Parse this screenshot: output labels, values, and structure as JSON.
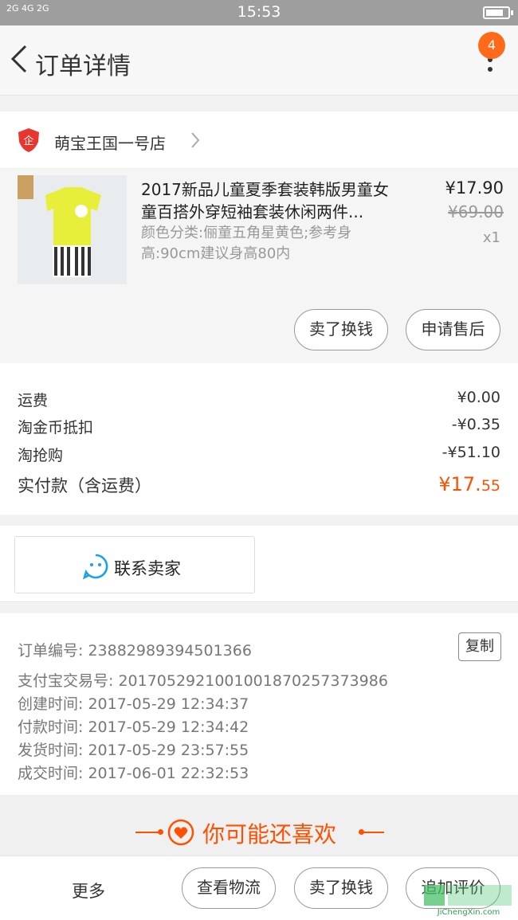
{
  "status_bar": {
    "signal": "2G 4G 2G",
    "time": "15:53"
  },
  "header": {
    "title": "订单详情",
    "badge": "4"
  },
  "shop": {
    "name": "萌宝王国一号店"
  },
  "product": {
    "title": "2017新品儿童夏季套装韩版男童女童百搭外穿短袖套装休闲两件...",
    "spec": "颜色分类:俪童五角星黄色;参考身高:90cm建议身高80内",
    "price": "¥17.90",
    "original_price": "¥69.00",
    "quantity": "x1",
    "actions": [
      "卖了换钱",
      "申请售后"
    ]
  },
  "summary": {
    "rows": [
      {
        "label": "运费",
        "value": "¥0.00"
      },
      {
        "label": "淘金币抵扣",
        "value": "-¥0.35"
      },
      {
        "label": "淘抢购",
        "value": "-¥51.10"
      }
    ],
    "total_label": "实付款（含运费）",
    "total_int": "¥17.",
    "total_dec": "55"
  },
  "contact": {
    "label": "联系卖家"
  },
  "order_info": {
    "copy_label": "复制",
    "rows": [
      "订单编号: 23882989394501366",
      "支付宝交易号: 2017052921001001870257373986",
      "创建时间: 2017-05-29 12:34:37",
      "付款时间: 2017-05-29 12:34:42",
      "发货时间: 2017-05-29 23:57:55",
      "成交时间: 2017-06-01 22:32:53"
    ]
  },
  "recommend": {
    "title": "你可能还喜欢"
  },
  "bottom_bar": {
    "more": "更多",
    "buttons": [
      "查看物流",
      "卖了换钱",
      "追加评价"
    ]
  },
  "watermark": {
    "text": "JiChengXin.com"
  },
  "colors": {
    "accent": "#ff5000",
    "badge": "#ff6a1a",
    "contact_icon": "#1aa1e8"
  }
}
